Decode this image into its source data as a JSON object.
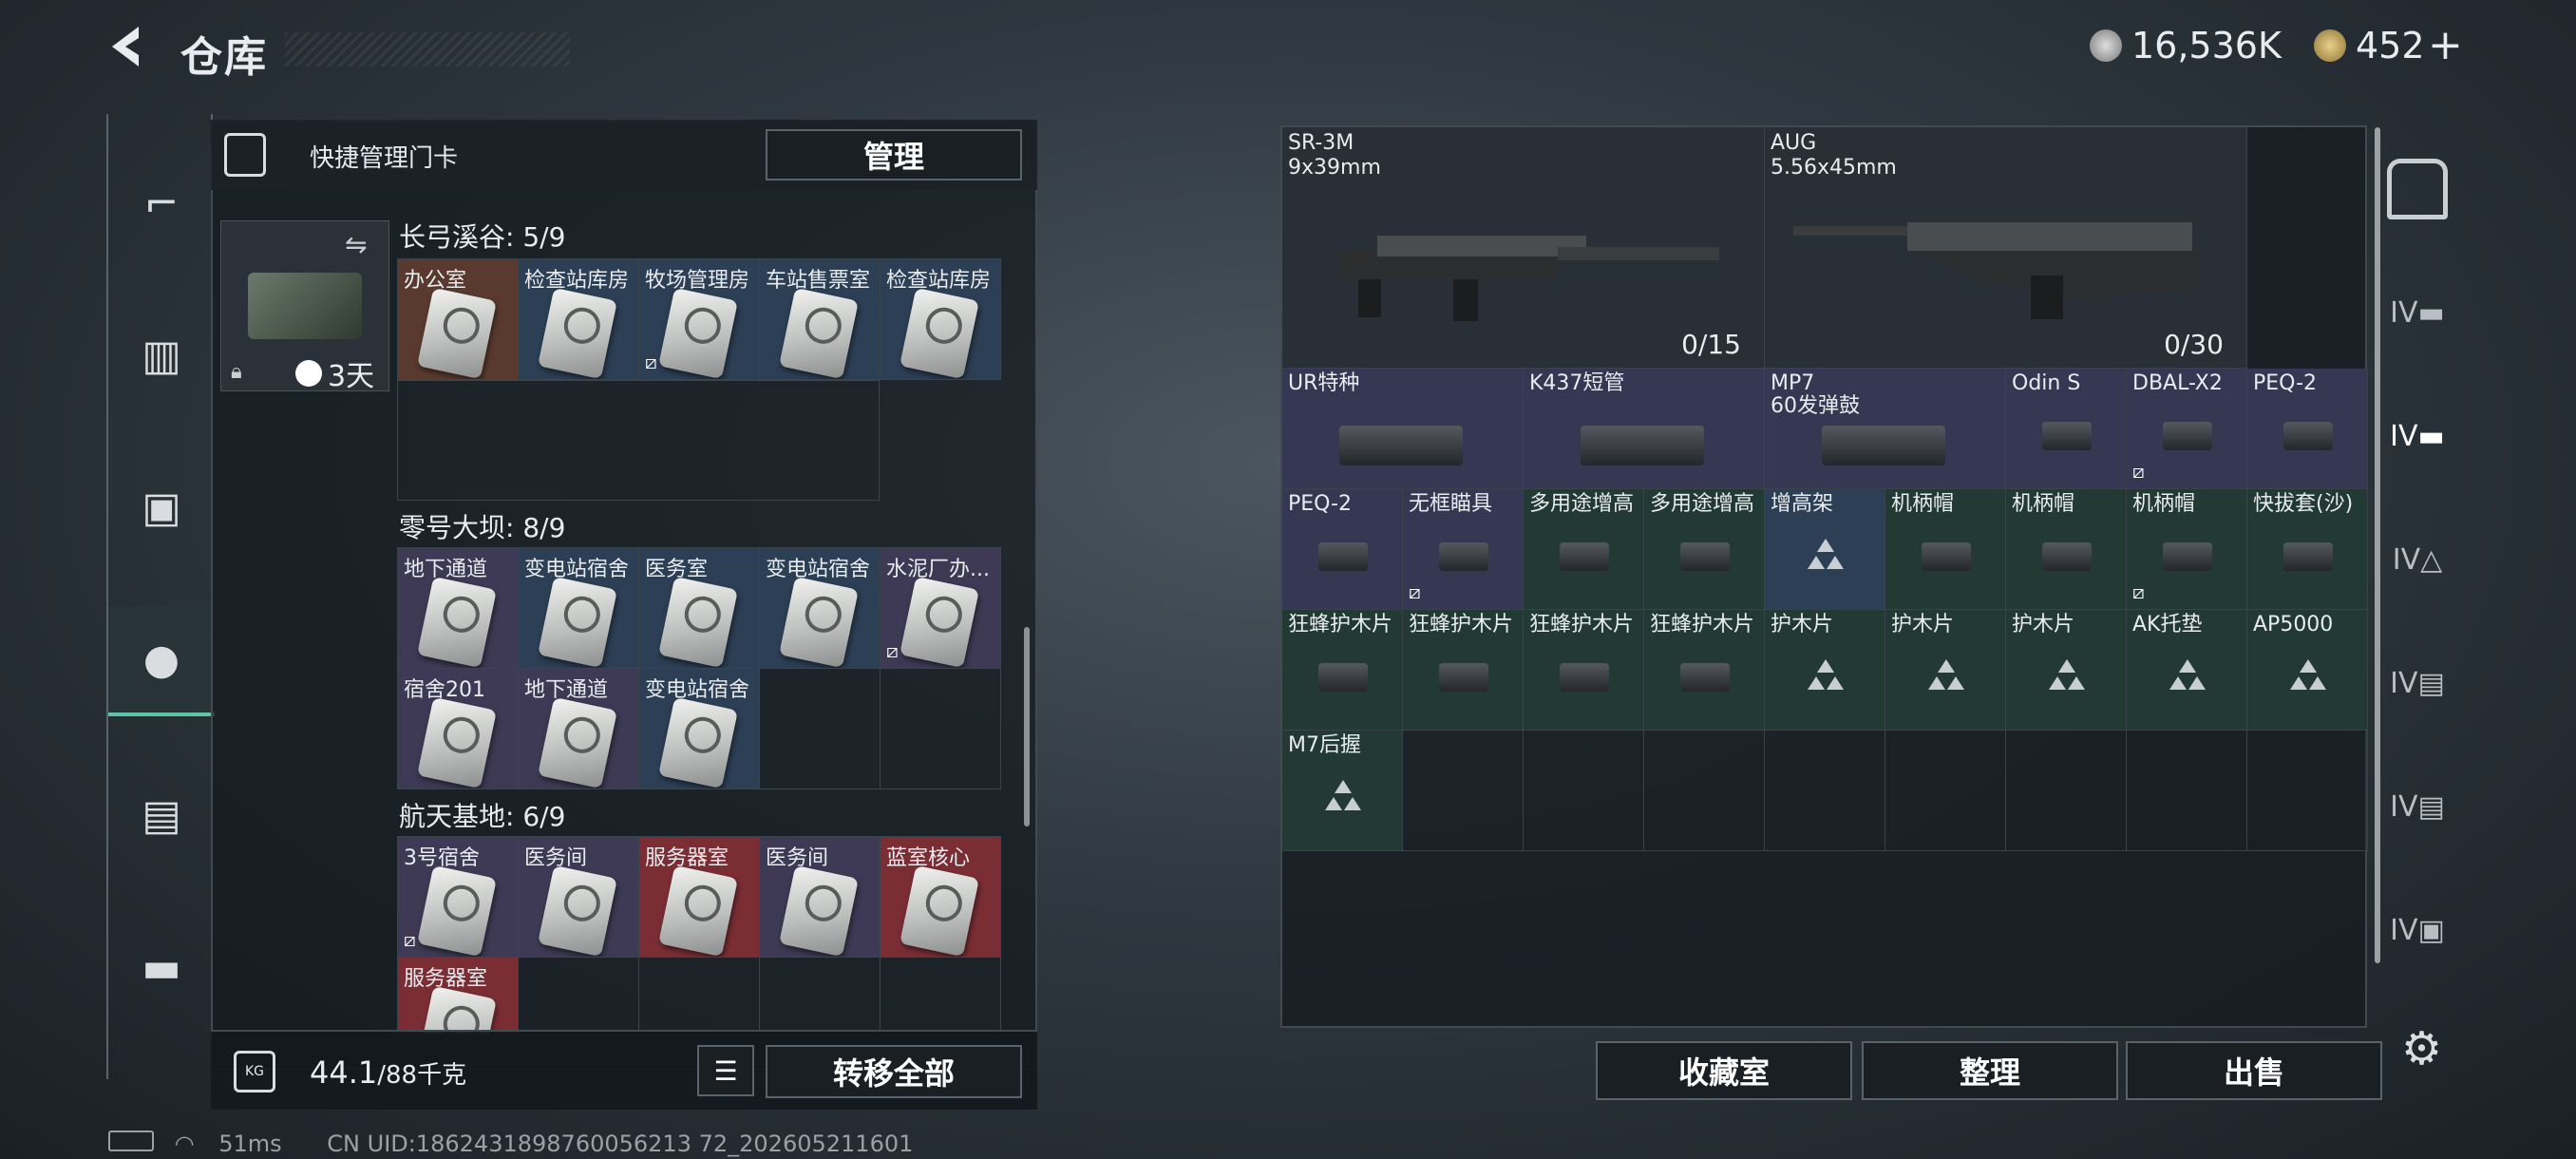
{
  "header": {
    "back_icon": "chevron-left-icon",
    "title": "仓库",
    "currency1": "16,536K",
    "currency2": "452",
    "plus": "+"
  },
  "keypanel": {
    "header_label": "快捷管理门卡",
    "manage_button": "管理",
    "case_time": "3天",
    "sections": [
      {
        "title": "长弓溪谷: 5/9",
        "cards": [
          {
            "label": "办公室",
            "color": "brown",
            "nolock": false
          },
          {
            "label": "检查站库房",
            "color": "blue",
            "nolock": false
          },
          {
            "label": "牧场管理房",
            "color": "blue",
            "nolock": true
          },
          {
            "label": "车站售票室",
            "color": "blue",
            "nolock": false
          },
          {
            "label": "检查站库房",
            "color": "blue",
            "nolock": false
          }
        ]
      },
      {
        "title": "零号大坝: 8/9",
        "cards": [
          {
            "label": "地下通道",
            "color": "purple",
            "nolock": false
          },
          {
            "label": "变电站宿舍",
            "color": "blue",
            "nolock": false
          },
          {
            "label": "医务室",
            "color": "blue",
            "nolock": false
          },
          {
            "label": "变电站宿舍",
            "color": "blue",
            "nolock": false
          },
          {
            "label": "水泥厂办...",
            "color": "purple",
            "nolock": true
          },
          {
            "label": "宿舍201",
            "color": "purple",
            "nolock": false
          },
          {
            "label": "地下通道",
            "color": "purple",
            "nolock": false
          },
          {
            "label": "变电站宿舍",
            "color": "blue",
            "nolock": false
          }
        ]
      },
      {
        "title": "航天基地: 6/9",
        "cards": [
          {
            "label": "3号宿舍",
            "color": "purple",
            "nolock": true
          },
          {
            "label": "医务间",
            "color": "purple",
            "nolock": false
          },
          {
            "label": "服务器室",
            "color": "red",
            "nolock": false
          },
          {
            "label": "医务间",
            "color": "purple",
            "nolock": false
          },
          {
            "label": "蓝室核心",
            "color": "red",
            "nolock": false
          },
          {
            "label": "服务器室",
            "color": "red",
            "nolock": false
          }
        ]
      }
    ],
    "weight_value": "44.1",
    "weight_total": "/88千克",
    "transfer_all": "转移全部"
  },
  "inventory": {
    "weapons": [
      {
        "name": "SR-3M",
        "caliber": "9x39mm",
        "ammo": "0/15"
      },
      {
        "name": "AUG",
        "caliber": "5.56x45mm",
        "ammo": "0/30"
      }
    ],
    "row2": [
      {
        "label": "UR特种",
        "bg": "purple",
        "span": 2
      },
      {
        "label": "K437短管",
        "bg": "purple",
        "span": 2
      },
      {
        "label": "MP7\n60发弹鼓",
        "bg": "purple",
        "span": 2
      },
      {
        "label": "Odin S",
        "bg": "purple",
        "span": 1
      },
      {
        "label": "DBAL-X2",
        "bg": "purple",
        "span": 1,
        "nolock": true
      },
      {
        "label": "PEQ-2",
        "bg": "purple",
        "span": 1
      }
    ],
    "row3": [
      {
        "label": "PEQ-2",
        "bg": "purple"
      },
      {
        "label": "无框瞄具",
        "bg": "purple",
        "nolock": true
      },
      {
        "label": "多用途增高",
        "bg": "green"
      },
      {
        "label": "多用途增高",
        "bg": "green"
      },
      {
        "label": "增高架",
        "bg": "blue",
        "tri": true
      },
      {
        "label": "机柄帽",
        "bg": "green"
      },
      {
        "label": "机柄帽",
        "bg": "green"
      },
      {
        "label": "机柄帽",
        "bg": "green",
        "nolock": true
      },
      {
        "label": "快拔套(沙)",
        "bg": "green"
      }
    ],
    "row4": [
      {
        "label": "狂蜂护木片",
        "bg": "green"
      },
      {
        "label": "狂蜂护木片",
        "bg": "green"
      },
      {
        "label": "狂蜂护木片",
        "bg": "green"
      },
      {
        "label": "狂蜂护木片",
        "bg": "green"
      },
      {
        "label": "护木片",
        "bg": "green",
        "tri": true
      },
      {
        "label": "护木片",
        "bg": "green",
        "tri": true
      },
      {
        "label": "护木片",
        "bg": "green",
        "tri": true
      },
      {
        "label": "AK托垫",
        "bg": "green",
        "tri": true
      },
      {
        "label": "AP5000",
        "bg": "green",
        "tri": true
      }
    ],
    "row5": [
      {
        "label": "M7后握",
        "bg": "green",
        "tri": true
      }
    ],
    "buttons": {
      "collection": "收藏室",
      "organize": "整理",
      "sell": "出售"
    }
  },
  "status": {
    "ping": "51ms",
    "uid": "CN UID:1862431898760056213 72_202605211601"
  },
  "colors": {
    "green": "#233a34",
    "purple": "#363752",
    "blue": "#2c3f55",
    "red": "#7a2e34",
    "brown": "#5a3a2e"
  }
}
